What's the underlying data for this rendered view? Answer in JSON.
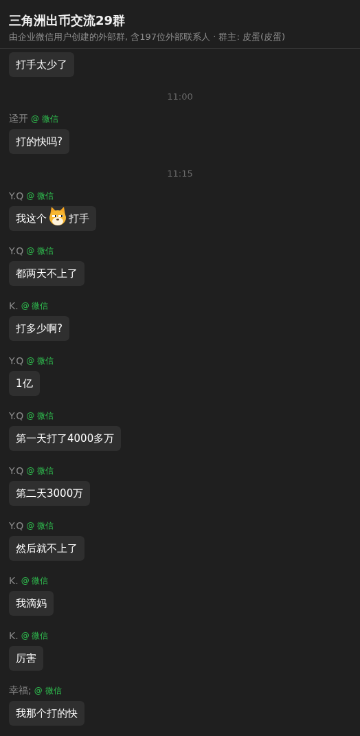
{
  "header": {
    "title": "三角洲出币交流29群",
    "subtitle": "由企业微信用户创建的外部群, 含197位外部联系人 · 群主: 皮蛋(皮蛋)"
  },
  "messages": [
    {
      "kind": "message",
      "segments": [
        {
          "kind": "text",
          "text": "打手太少了"
        }
      ]
    },
    {
      "kind": "time",
      "text": "11:00"
    },
    {
      "kind": "message",
      "sender": "迳开",
      "tag": "@ 微信",
      "segments": [
        {
          "kind": "text",
          "text": "打的快吗?"
        }
      ]
    },
    {
      "kind": "time",
      "text": "11:15"
    },
    {
      "kind": "message",
      "sender": "Y.Q",
      "tag": "@ 微信",
      "segments": [
        {
          "kind": "text",
          "text": "我这个"
        },
        {
          "kind": "emoji"
        },
        {
          "kind": "text",
          "text": "打手"
        }
      ]
    },
    {
      "kind": "message",
      "sender": "Y.Q",
      "tag": "@ 微信",
      "segments": [
        {
          "kind": "text",
          "text": "都两天不上了"
        }
      ]
    },
    {
      "kind": "message",
      "sender": "K.",
      "tag": "@ 微信",
      "segments": [
        {
          "kind": "text",
          "text": "打多少啊?"
        }
      ]
    },
    {
      "kind": "message",
      "sender": "Y.Q",
      "tag": "@ 微信",
      "segments": [
        {
          "kind": "text",
          "text": "1亿"
        }
      ]
    },
    {
      "kind": "message",
      "sender": "Y.Q",
      "tag": "@ 微信",
      "segments": [
        {
          "kind": "text",
          "text": "第一天打了4000多万"
        }
      ]
    },
    {
      "kind": "message",
      "sender": "Y.Q",
      "tag": "@ 微信",
      "segments": [
        {
          "kind": "text",
          "text": "第二天3000万"
        }
      ]
    },
    {
      "kind": "message",
      "sender": "Y.Q",
      "tag": "@ 微信",
      "segments": [
        {
          "kind": "text",
          "text": "然后就不上了"
        }
      ]
    },
    {
      "kind": "message",
      "sender": "K.",
      "tag": "@ 微信",
      "segments": [
        {
          "kind": "text",
          "text": "我滴妈"
        }
      ]
    },
    {
      "kind": "message",
      "sender": "K.",
      "tag": "@ 微信",
      "segments": [
        {
          "kind": "text",
          "text": "厉害"
        }
      ]
    },
    {
      "kind": "message",
      "sender": "幸福;",
      "tag": "@ 微信",
      "segments": [
        {
          "kind": "text",
          "text": "我那个打的快"
        }
      ]
    }
  ]
}
